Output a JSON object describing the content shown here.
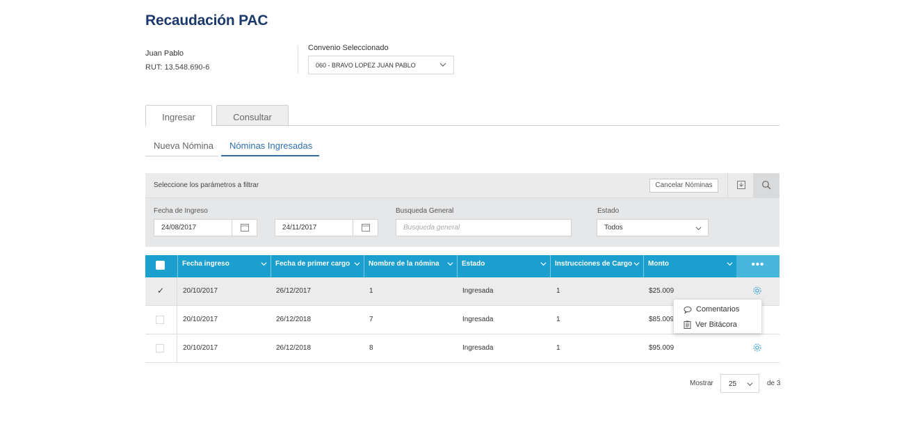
{
  "page": {
    "title": "Recaudación PAC"
  },
  "user": {
    "name": "Juan Pablo",
    "rut": "RUT: 13.548.690-6"
  },
  "convenio": {
    "label": "Convenio Seleccionado",
    "selected": "060 - BRAVO LOPEZ JUAN PABLO"
  },
  "tabs": [
    {
      "label": "Ingresar",
      "active": true
    },
    {
      "label": "Consultar",
      "active": false
    }
  ],
  "subtabs": [
    {
      "label": "Nueva Nómina",
      "active": false
    },
    {
      "label": "Nóminas Ingresadas",
      "active": true
    }
  ],
  "filter": {
    "hint": "Seleccione los parámetros a filtrar",
    "cancel_label": "Cancelar Nóminas",
    "fecha_label": "Fecha de Ingreso",
    "fecha_desde": "24/08/2017",
    "fecha_hasta": "24/11/2017",
    "busqueda_label": "Busqueda General",
    "busqueda_placeholder": "Busqueda general",
    "estado_label": "Estado",
    "estado_value": "Todos"
  },
  "table": {
    "columns": [
      "Fecha ingreso",
      "Fecha de primer cargo",
      "Nombre de la nómina",
      "Estado",
      "Instrucciones de Cargo",
      "Monto"
    ],
    "more_label": "•••",
    "rows": [
      {
        "checked": true,
        "fecha_ingreso": "20/10/2017",
        "primer_cargo": "26/12/2017",
        "nombre": "1",
        "estado": "Ingresada",
        "instrucciones": "1",
        "monto": "$25.009"
      },
      {
        "checked": false,
        "fecha_ingreso": "20/10/2017",
        "primer_cargo": "26/12/2018",
        "nombre": "7",
        "estado": "Ingresada",
        "instrucciones": "1",
        "monto": "$85.009"
      },
      {
        "checked": false,
        "fecha_ingreso": "20/10/2017",
        "primer_cargo": "26/12/2018",
        "nombre": "8",
        "estado": "Ingresada",
        "instrucciones": "1",
        "monto": "$95.009"
      }
    ]
  },
  "row_menu": {
    "items": [
      {
        "label": "Comentarios",
        "icon": "comment-icon"
      },
      {
        "label": "Ver Bitácora",
        "icon": "clipboard-icon"
      }
    ]
  },
  "pager": {
    "label": "Mostrar",
    "page_size": "25",
    "total": "de 3"
  },
  "colors": {
    "title": "#1b3a6b",
    "table_header": "#1a9fcf",
    "accent": "#2f6fb0",
    "gear": "#3a9fd8"
  }
}
